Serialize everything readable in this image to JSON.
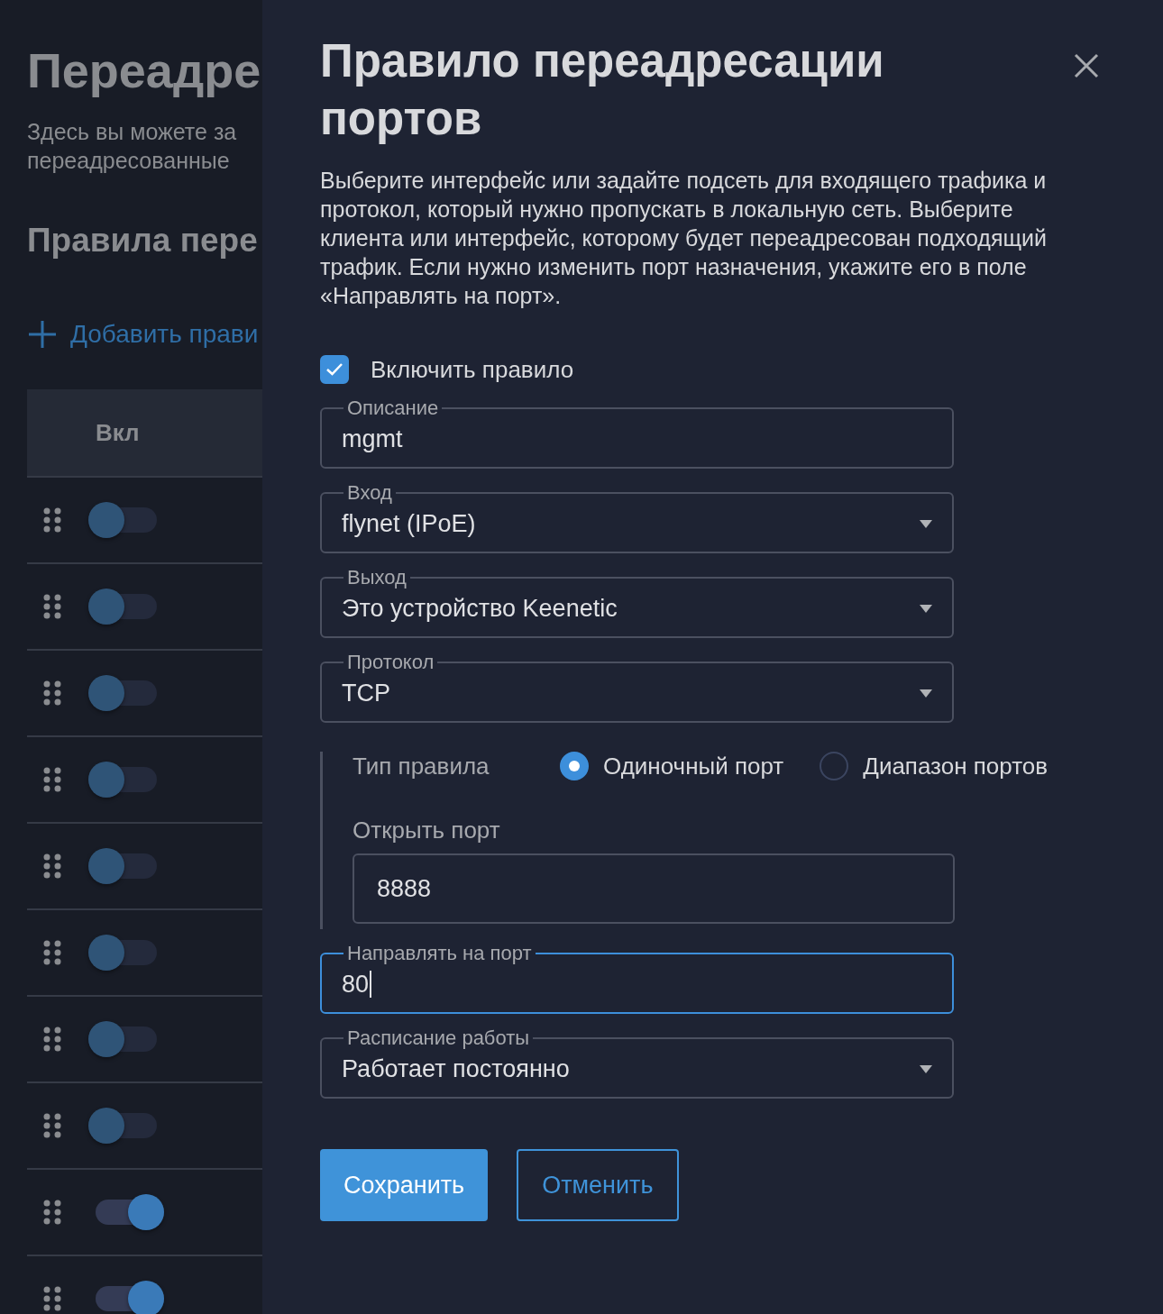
{
  "page": {
    "title": "Переадре",
    "description_lines": [
      "Здесь вы можете за",
      "переадресованные"
    ],
    "section_title": "Правила пере",
    "add_link": "Добавить прави",
    "table": {
      "columns": [
        "Вкл"
      ],
      "rows": [
        {
          "on": false
        },
        {
          "on": false
        },
        {
          "on": false
        },
        {
          "on": false
        },
        {
          "on": false
        },
        {
          "on": false
        },
        {
          "on": false
        },
        {
          "on": false
        },
        {
          "on": true
        },
        {
          "on": true
        }
      ]
    }
  },
  "dialog": {
    "title": "Правило переадресации портов",
    "description": "Выберите интерфейс или задайте подсеть для входящего трафика и протокол, который нужно пропускать в локальную сеть. Выберите клиента или интерфейс, которому будет переадресован подходящий трафик. Если нужно изменить порт назначения, укажите его в поле «Направлять на порт».",
    "enable": {
      "label": "Включить правило",
      "checked": true
    },
    "fields": [
      {
        "kind": "text",
        "label": "Описание",
        "value": "mgmt",
        "focused": false
      },
      {
        "kind": "select",
        "label": "Вход",
        "value": "flynet (IPoE)",
        "focused": false
      },
      {
        "kind": "select",
        "label": "Выход",
        "value": "Это устройство Keenetic",
        "focused": false
      },
      {
        "kind": "select",
        "label": "Протокол",
        "value": "TCP",
        "focused": false
      }
    ],
    "rule_type": {
      "label": "Тип правила",
      "options": [
        {
          "label": "Одиночный порт",
          "selected": true
        },
        {
          "label": "Диапазон портов",
          "selected": false
        }
      ]
    },
    "open_port": {
      "label": "Открыть порт",
      "value": "8888"
    },
    "fields_after": [
      {
        "kind": "text",
        "label": "Направлять на порт",
        "value": "80",
        "focused": true
      },
      {
        "kind": "select",
        "label": "Расписание работы",
        "value": "Работает постоянно",
        "focused": false
      }
    ],
    "buttons": [
      {
        "label": "Сохранить",
        "kind": "primary"
      },
      {
        "label": "Отменить",
        "kind": "secondary"
      }
    ]
  }
}
